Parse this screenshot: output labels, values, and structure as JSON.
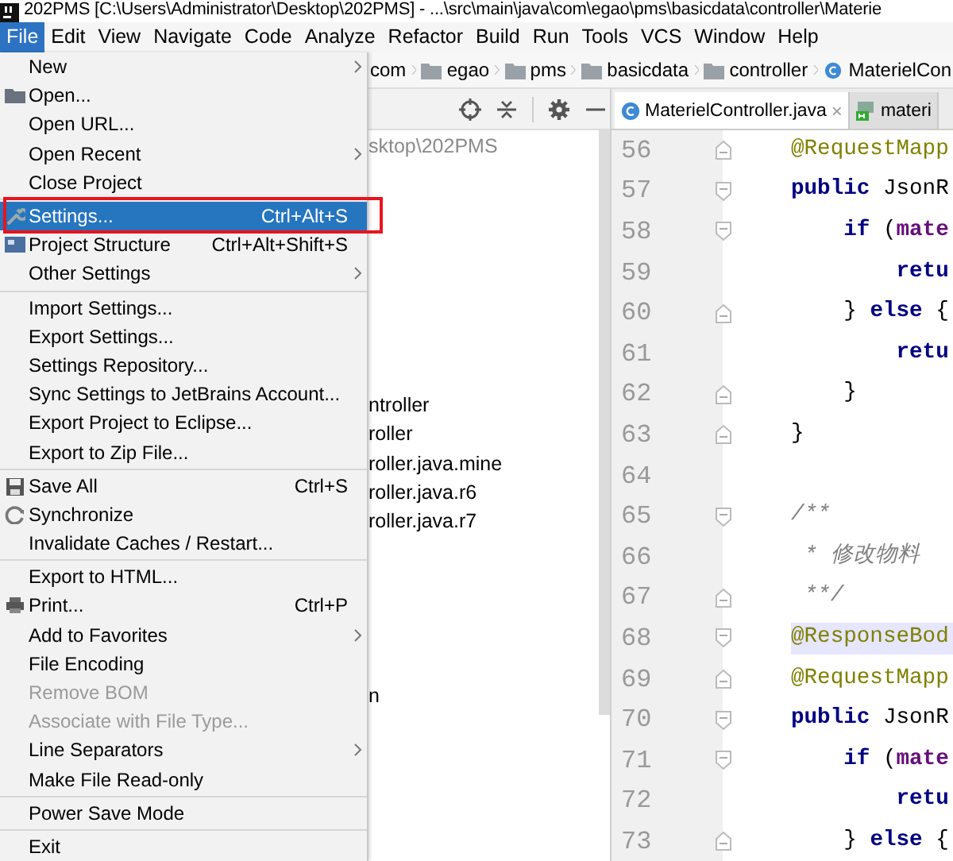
{
  "window": {
    "title": "202PMS [C:\\Users\\Administrator\\Desktop\\202PMS] - ...\\src\\main\\java\\com\\egao\\pms\\basicdata\\controller\\Materie"
  },
  "menubar": [
    {
      "label": "File",
      "selected": true
    },
    {
      "label": "Edit",
      "selected": false
    },
    {
      "label": "View",
      "selected": false
    },
    {
      "label": "Navigate",
      "selected": false
    },
    {
      "label": "Code",
      "selected": false
    },
    {
      "label": "Analyze",
      "selected": false
    },
    {
      "label": "Refactor",
      "selected": false
    },
    {
      "label": "Build",
      "selected": false
    },
    {
      "label": "Run",
      "selected": false
    },
    {
      "label": "Tools",
      "selected": false
    },
    {
      "label": "VCS",
      "selected": false
    },
    {
      "label": "Window",
      "selected": false
    },
    {
      "label": "Help",
      "selected": false
    }
  ],
  "file_menu": {
    "groups": [
      [
        {
          "label": "New",
          "kind": "plain",
          "submenu": true,
          "disabled": false,
          "selected": false
        },
        {
          "label": "Open...",
          "kind": "folder",
          "submenu": false,
          "disabled": false,
          "selected": false
        },
        {
          "label": "Open URL...",
          "kind": "plain",
          "submenu": false,
          "disabled": false,
          "selected": false
        },
        {
          "label": "Open Recent",
          "kind": "plain",
          "submenu": true,
          "disabled": false,
          "selected": false
        },
        {
          "label": "Close Project",
          "kind": "plain",
          "submenu": false,
          "disabled": false,
          "selected": false
        }
      ],
      [
        {
          "label": "Settings...",
          "kind": "wrench",
          "shortcut": "Ctrl+Alt+S",
          "submenu": false,
          "disabled": false,
          "selected": true
        },
        {
          "label": "Project Structure",
          "kind": "structure",
          "shortcut": "Ctrl+Alt+Shift+S",
          "submenu": false,
          "disabled": false,
          "selected": false
        },
        {
          "label": "Other Settings",
          "kind": "plain",
          "submenu": true,
          "disabled": false,
          "selected": false
        }
      ],
      [
        {
          "label": "Import Settings...",
          "kind": "plain",
          "submenu": false,
          "disabled": false,
          "selected": false
        },
        {
          "label": "Export Settings...",
          "kind": "plain",
          "submenu": false,
          "disabled": false,
          "selected": false
        },
        {
          "label": "Settings Repository...",
          "kind": "plain",
          "submenu": false,
          "disabled": false,
          "selected": false
        },
        {
          "label": "Sync Settings to JetBrains Account...",
          "kind": "plain",
          "submenu": false,
          "disabled": false,
          "selected": false
        },
        {
          "label": "Export Project to Eclipse...",
          "kind": "plain",
          "submenu": false,
          "disabled": false,
          "selected": false
        },
        {
          "label": "Export to Zip File...",
          "kind": "plain",
          "submenu": false,
          "disabled": false,
          "selected": false
        }
      ],
      [
        {
          "label": "Save All",
          "kind": "floppy",
          "shortcut": "Ctrl+S",
          "submenu": false,
          "disabled": false,
          "selected": false
        },
        {
          "label": "Synchronize",
          "kind": "refresh",
          "submenu": false,
          "disabled": false,
          "selected": false
        },
        {
          "label": "Invalidate Caches / Restart...",
          "kind": "plain",
          "submenu": false,
          "disabled": false,
          "selected": false
        }
      ],
      [
        {
          "label": "Export to HTML...",
          "kind": "plain",
          "submenu": false,
          "disabled": false,
          "selected": false
        },
        {
          "label": "Print...",
          "kind": "printer",
          "shortcut": "Ctrl+P",
          "submenu": false,
          "disabled": false,
          "selected": false
        },
        {
          "label": "Add to Favorites",
          "kind": "plain",
          "submenu": true,
          "disabled": false,
          "selected": false
        },
        {
          "label": "File Encoding",
          "kind": "plain",
          "submenu": false,
          "disabled": false,
          "selected": false
        },
        {
          "label": "Remove BOM",
          "kind": "plain",
          "submenu": false,
          "disabled": true,
          "selected": false
        },
        {
          "label": "Associate with File Type...",
          "kind": "plain",
          "submenu": false,
          "disabled": true,
          "selected": false
        },
        {
          "label": "Line Separators",
          "kind": "plain",
          "submenu": true,
          "disabled": false,
          "selected": false
        },
        {
          "label": "Make File Read-only",
          "kind": "plain",
          "submenu": false,
          "disabled": false,
          "selected": false
        }
      ],
      [
        {
          "label": "Power Save Mode",
          "kind": "plain",
          "submenu": false,
          "disabled": false,
          "selected": false
        }
      ],
      [
        {
          "label": "Exit",
          "kind": "plain",
          "submenu": false,
          "disabled": false,
          "selected": false
        }
      ]
    ]
  },
  "breadcrumb": [
    {
      "label": "com",
      "kind": "package"
    },
    {
      "label": "egao",
      "kind": "folder"
    },
    {
      "label": "pms",
      "kind": "folder"
    },
    {
      "label": "basicdata",
      "kind": "folder"
    },
    {
      "label": "controller",
      "kind": "folder"
    },
    {
      "label": "MaterielCon",
      "kind": "class"
    }
  ],
  "project_panel": {
    "rows": [
      {
        "label": "sktop\\202PMS",
        "kind": "path"
      },
      {
        "label": "ntroller",
        "kind": "file"
      },
      {
        "label": "roller",
        "kind": "file"
      },
      {
        "label": "roller.java.mine",
        "kind": "file"
      },
      {
        "label": "roller.java.r6",
        "kind": "file"
      },
      {
        "label": "roller.java.r7",
        "kind": "file"
      },
      {
        "label": "n",
        "kind": "file"
      }
    ]
  },
  "editor": {
    "tabs": [
      {
        "label": "MaterielController.java",
        "kind": "class",
        "close": "×",
        "selected": true
      },
      {
        "label": "materi",
        "kind": "html",
        "selected": false
      }
    ],
    "lines": [
      {
        "number": "56",
        "kind": "fold_end",
        "tokens": [
          {
            "text": "@RequestMapp",
            "kind": "annotation"
          }
        ]
      },
      {
        "number": "57",
        "kind": "fold_start",
        "tokens": [
          {
            "text": "public",
            "kind": "keyword"
          },
          {
            "text": " JsonR",
            "kind": "plain"
          }
        ]
      },
      {
        "number": "58",
        "kind": "fold_start",
        "tokens": [
          {
            "text": "    if",
            "kind": "keyword"
          },
          {
            "text": " (",
            "kind": "plain"
          },
          {
            "text": "mate",
            "kind": "field"
          }
        ]
      },
      {
        "number": "59",
        "kind": "plain",
        "tokens": [
          {
            "text": "        retu",
            "kind": "keyword"
          }
        ]
      },
      {
        "number": "60",
        "kind": "fold_end",
        "tokens": [
          {
            "text": "    } ",
            "kind": "plain"
          },
          {
            "text": "else",
            "kind": "keyword"
          },
          {
            "text": " {",
            "kind": "plain"
          }
        ]
      },
      {
        "number": "61",
        "kind": "plain",
        "tokens": [
          {
            "text": "        retu",
            "kind": "keyword"
          }
        ]
      },
      {
        "number": "62",
        "kind": "fold_end",
        "tokens": [
          {
            "text": "    }",
            "kind": "plain"
          }
        ]
      },
      {
        "number": "63",
        "kind": "fold_end",
        "tokens": [
          {
            "text": "}",
            "kind": "plain"
          }
        ]
      },
      {
        "number": "64",
        "kind": "plain"
      },
      {
        "number": "65",
        "kind": "fold_start",
        "tokens": [
          {
            "text": "/**",
            "kind": "comment"
          }
        ]
      },
      {
        "number": "66",
        "kind": "plain",
        "tokens": [
          {
            "text": " * 修改物料",
            "kind": "comment"
          }
        ]
      },
      {
        "number": "67",
        "kind": "fold_end",
        "tokens": [
          {
            "text": " **/",
            "kind": "comment"
          }
        ]
      },
      {
        "number": "68",
        "kind": "fold_start",
        "highlighted": true,
        "tokens": [
          {
            "text": "@ResponseBod",
            "kind": "annotation"
          }
        ]
      },
      {
        "number": "69",
        "kind": "fold_end",
        "tokens": [
          {
            "text": "@RequestMapp",
            "kind": "annotation"
          }
        ]
      },
      {
        "number": "70",
        "kind": "fold_start",
        "tokens": [
          {
            "text": "public",
            "kind": "keyword"
          },
          {
            "text": " JsonR",
            "kind": "plain"
          }
        ]
      },
      {
        "number": "71",
        "kind": "fold_start",
        "tokens": [
          {
            "text": "    if",
            "kind": "keyword"
          },
          {
            "text": " (",
            "kind": "plain"
          },
          {
            "text": "mate",
            "kind": "field"
          }
        ]
      },
      {
        "number": "72",
        "kind": "plain",
        "tokens": [
          {
            "text": "        retu",
            "kind": "keyword"
          }
        ]
      },
      {
        "number": "73",
        "kind": "fold_end",
        "tokens": [
          {
            "text": "    } ",
            "kind": "plain"
          },
          {
            "text": "else",
            "kind": "keyword"
          },
          {
            "text": " {",
            "kind": "plain"
          }
        ]
      }
    ]
  }
}
